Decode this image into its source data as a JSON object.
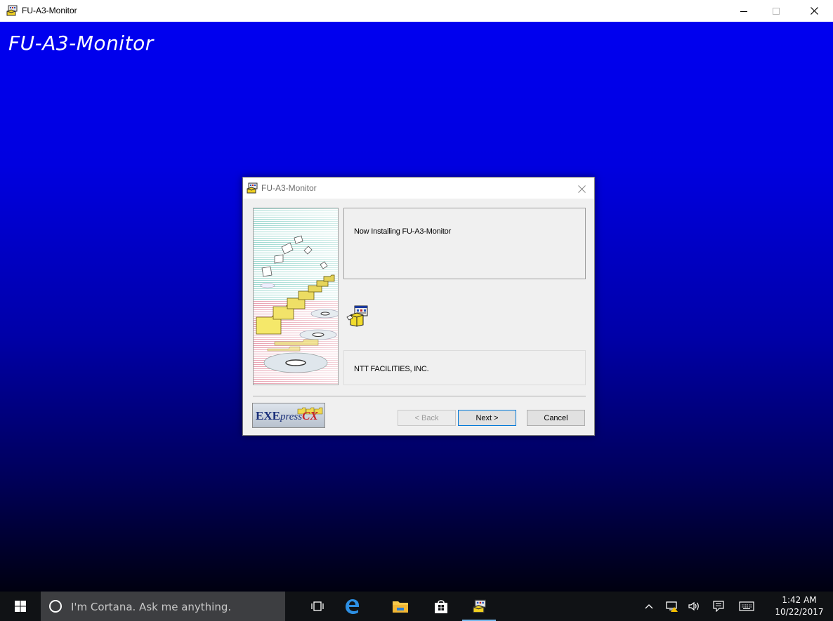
{
  "window": {
    "title": "FU-A3-Monitor",
    "minimize_glyph": "—",
    "maximize_glyph": "☐",
    "close_glyph": "✕"
  },
  "background": {
    "title": "FU-A3-Monitor",
    "gradient_top": "#0000f0",
    "gradient_bottom": "#000010"
  },
  "dialog": {
    "title": "FU-A3-Monitor",
    "message": "Now Installing FU-A3-Monitor",
    "company": "NTT FACILITIES, INC.",
    "logo_icon": "exepress-cx-logo",
    "setup_icon": "setup-package-icon",
    "buttons": {
      "back": "< Back",
      "next": "Next >",
      "cancel": "Cancel"
    },
    "close_glyph": "✕"
  },
  "taskbar": {
    "search_placeholder": "I'm Cortana. Ask me anything.",
    "pinned": [
      "task-view-icon",
      "edge-icon",
      "file-explorer-icon",
      "store-icon",
      "fu-a3-monitor-app-icon"
    ],
    "tray": [
      "chevron-up-icon",
      "network-warning-icon",
      "volume-icon",
      "action-center-icon",
      "keyboard-icon"
    ],
    "time": "1:42 AM",
    "date": "10/22/2017",
    "accent": "#76b9ed"
  }
}
